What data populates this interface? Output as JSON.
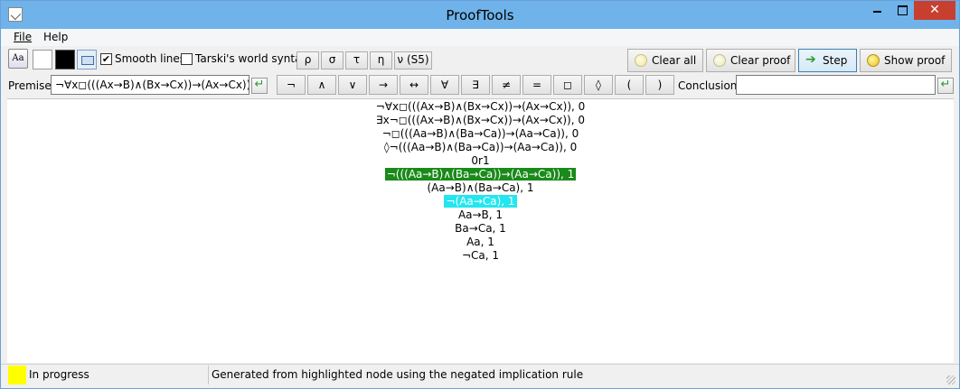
{
  "window": {
    "title": "ProofTools",
    "close_glyph": "✕"
  },
  "menu": {
    "file": "File",
    "help": "Help"
  },
  "toolbar": {
    "font_button": "Aa",
    "smooth_lines": {
      "label": "Smooth lines",
      "checked": true,
      "check_glyph": "✔"
    },
    "tarski_syntax": {
      "label": "Tarski's world syntax",
      "checked": false
    },
    "modal_buttons": [
      "ρ",
      "σ",
      "τ",
      "η",
      "ν (S5)"
    ],
    "clear_all": "Clear all",
    "clear_proof": "Clear proof",
    "step": "Step",
    "show_proof": "Show proof"
  },
  "premise": {
    "label": "Premise:",
    "value": "¬∀x◻(((Ax→B)∧(Bx→Cx))→(Ax→Cx))",
    "enter_glyph": "↵"
  },
  "symbols": [
    "¬",
    "∧",
    "∨",
    "→",
    "↔",
    "∀",
    "∃",
    "≠",
    "=",
    "◻",
    "◊",
    "(",
    ")"
  ],
  "conclusion": {
    "label": "Conclusion:",
    "value": ""
  },
  "proof_lines": [
    {
      "text": "¬∀x◻(((Ax→B)∧(Bx→Cx))→(Ax→Cx)), 0",
      "highlight": "none"
    },
    {
      "text": "∃x¬◻(((Ax→B)∧(Bx→Cx))→(Ax→Cx)), 0",
      "highlight": "none"
    },
    {
      "text": "¬◻(((Aa→B)∧(Ba→Ca))→(Aa→Ca)), 0",
      "highlight": "none"
    },
    {
      "text": "◊¬(((Aa→B)∧(Ba→Ca))→(Aa→Ca)), 0",
      "highlight": "none"
    },
    {
      "text": "0r1",
      "highlight": "none"
    },
    {
      "text": "¬(((Aa→B)∧(Ba→Ca))→(Aa→Ca)), 1",
      "highlight": "green"
    },
    {
      "text": "(Aa→B)∧(Ba→Ca), 1",
      "highlight": "none"
    },
    {
      "text": "¬(Aa→Ca), 1",
      "highlight": "cyan"
    },
    {
      "text": "Aa→B, 1",
      "highlight": "none"
    },
    {
      "text": "Ba→Ca, 1",
      "highlight": "none"
    },
    {
      "text": "Aa, 1",
      "highlight": "none"
    },
    {
      "text": "¬Ca, 1",
      "highlight": "none"
    }
  ],
  "status": {
    "state": "In progress",
    "state_color": "#ffff00",
    "message": "Generated from highlighted node using the negated implication rule"
  },
  "colors": {
    "highlight_green": "#1a8a1a",
    "highlight_cyan": "#22e6f0",
    "titlebar": "#6fb3ea"
  }
}
